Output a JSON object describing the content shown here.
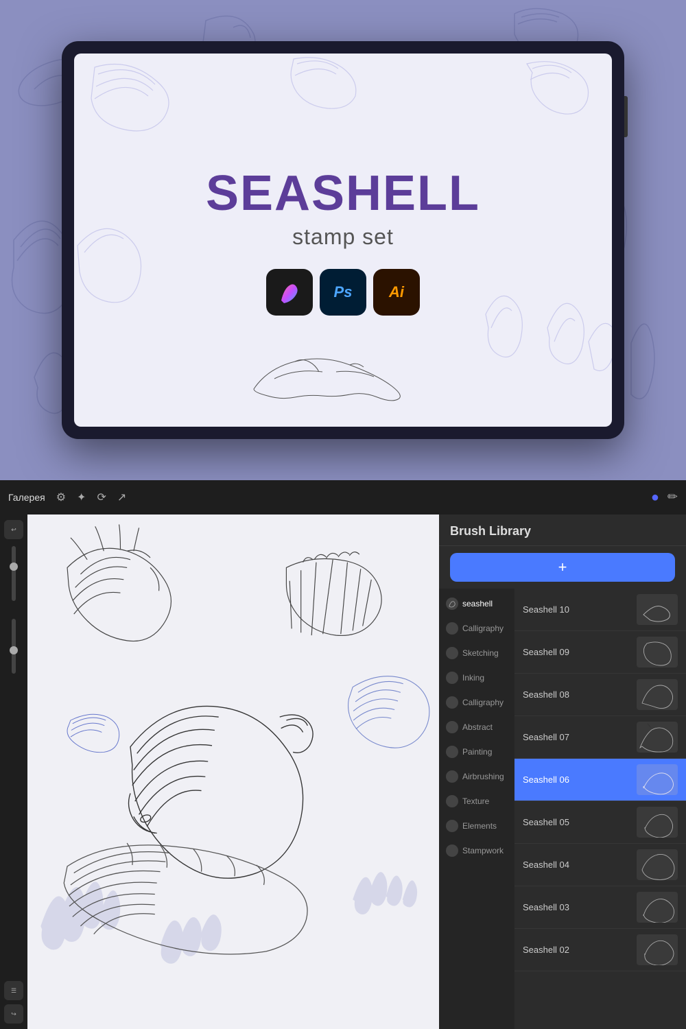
{
  "top": {
    "screen": {
      "title": "SEASHELL",
      "subtitle": "stamp set"
    },
    "app_icons": [
      {
        "name": "Procreate",
        "label": "✦",
        "bg": "procreate"
      },
      {
        "name": "Photoshop",
        "label": "Ps",
        "bg": "ps"
      },
      {
        "name": "Illustrator",
        "label": "Ai",
        "bg": "ai"
      }
    ]
  },
  "toolbar": {
    "gallery": "Галерея",
    "icons": [
      "⚙",
      "✂",
      "↺",
      "↗"
    ],
    "right_icons": [
      "✏",
      "🖌"
    ]
  },
  "brush_library": {
    "header": "Brush Library",
    "add_button": "+",
    "categories": [
      {
        "label": "seashell",
        "active": true
      },
      {
        "label": "Calligraphy"
      },
      {
        "label": "Sketching"
      },
      {
        "label": "Inking"
      },
      {
        "label": "Calligraphy"
      },
      {
        "label": "Abstract"
      },
      {
        "label": "Painting"
      },
      {
        "label": "Airbrushing"
      },
      {
        "label": "Texture"
      },
      {
        "label": "Elements"
      },
      {
        "label": "Stampwork"
      }
    ],
    "brushes": [
      {
        "name": "Seashell 10",
        "selected": false
      },
      {
        "name": "Seashell 09",
        "selected": false
      },
      {
        "name": "Seashell 08",
        "selected": false
      },
      {
        "name": "Seashell 07",
        "selected": false
      },
      {
        "name": "Seashell 06",
        "selected": true
      },
      {
        "name": "Seashell 05",
        "selected": false
      },
      {
        "name": "Seashell 04",
        "selected": false
      },
      {
        "name": "Seashell 03",
        "selected": false
      },
      {
        "name": "Seashell 02",
        "selected": false
      }
    ]
  }
}
